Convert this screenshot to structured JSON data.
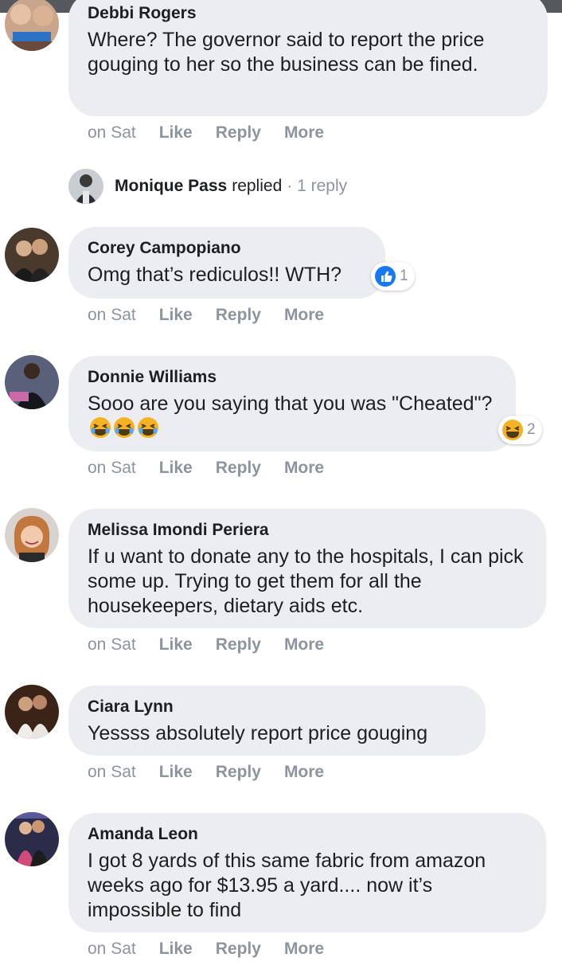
{
  "comments": [
    {
      "author": "Debbi Rogers",
      "text": "Where? The governor said to report the price gouging to her so the business can be fined.",
      "time": "on Sat",
      "like": "Like",
      "reply": "Reply",
      "more": "More"
    },
    {
      "author": "Corey Campopiano",
      "text": "Omg that’s rediculos!! WTH?",
      "time": "on Sat",
      "like": "Like",
      "reply": "Reply",
      "more": "More",
      "reaction": {
        "icon": "thumbs-up-icon",
        "count": "1",
        "color": "#1877f2"
      }
    },
    {
      "author": "Donnie Williams",
      "text": "Sooo are you saying that you was \"Cheated\"?",
      "time": "on Sat",
      "like": "Like",
      "reply": "Reply",
      "more": "More",
      "reaction": {
        "icon": "laughing-emoji-icon",
        "count": "2",
        "color": "#f7b125"
      }
    },
    {
      "author": "Melissa Imondi Periera",
      "text": "If u want to donate any to the hospitals, I can pick some up. Trying to get them for all the housekeepers, dietary aids etc.",
      "time": "on Sat",
      "like": "Like",
      "reply": "Reply",
      "more": "More"
    },
    {
      "author": "Ciara Lynn",
      "text": "Yessss absolutely report price gouging",
      "time": "on Sat",
      "like": "Like",
      "reply": "Reply",
      "more": "More"
    },
    {
      "author": "Amanda Leon",
      "text": "I got 8 yards of this same fabric from amazon weeks ago for $13.95 a yard.... now it’s impossible to find",
      "time": "on Sat",
      "like": "Like",
      "reply": "Reply",
      "more": "More"
    }
  ],
  "replied": {
    "name": "Monique Pass",
    "verb": "replied",
    "count": "· 1 reply"
  },
  "colors": {
    "bubble": "#ebedf0",
    "meta": "#8d949e",
    "text": "#1c1e21",
    "like_blue": "#1877f2",
    "emoji_yellow": "#f7b125"
  }
}
